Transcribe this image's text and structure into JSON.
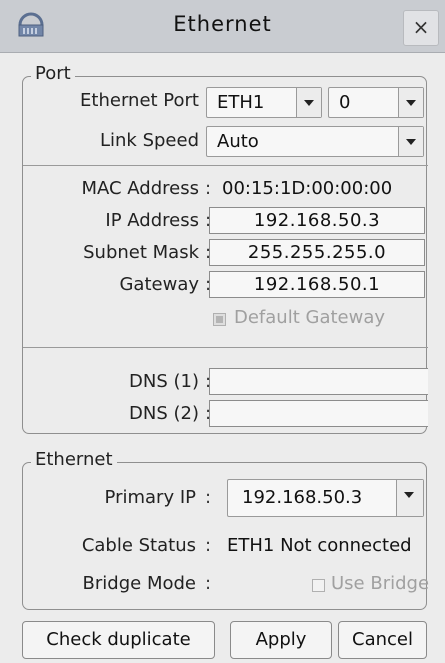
{
  "window": {
    "title": "Ethernet",
    "close_glyph": "×",
    "icon": "network-device-icon"
  },
  "port_group": {
    "title": "Port",
    "ethernet_port_label": "Ethernet Port",
    "ethernet_port_value": "ETH1",
    "port_index_value": "0",
    "link_speed_label": "Link Speed",
    "link_speed_value": "Auto",
    "mac_label": "MAC Address",
    "mac_value": "00:15:1D:00:00:00",
    "ip_label": "IP Address",
    "ip_value": "192.168.50.3",
    "subnet_label": "Subnet Mask",
    "subnet_value": "255.255.255.0",
    "gateway_label": "Gateway",
    "gateway_value": "192.168.50.1",
    "default_gateway_label": "Default Gateway",
    "default_gateway_checked": true,
    "dns1_label": "DNS (1)",
    "dns1_value": "",
    "dns2_label": "DNS (2)",
    "dns2_value": "",
    "separator": ":"
  },
  "ethernet_group": {
    "title": "Ethernet",
    "primary_ip_label": "Primary IP",
    "primary_ip_value": "192.168.50.3",
    "cable_status_label": "Cable Status",
    "cable_status_value": "ETH1 Not connected",
    "bridge_mode_label": "Bridge Mode",
    "use_bridge_label": "Use Bridge",
    "use_bridge_checked": false,
    "separator": ":"
  },
  "buttons": {
    "check_duplicate": "Check duplicate",
    "apply": "Apply",
    "cancel": "Cancel"
  },
  "colors": {
    "titlebar": "#c9ccd1",
    "background": "#ececec",
    "disabled_text": "#a0a0a0"
  }
}
